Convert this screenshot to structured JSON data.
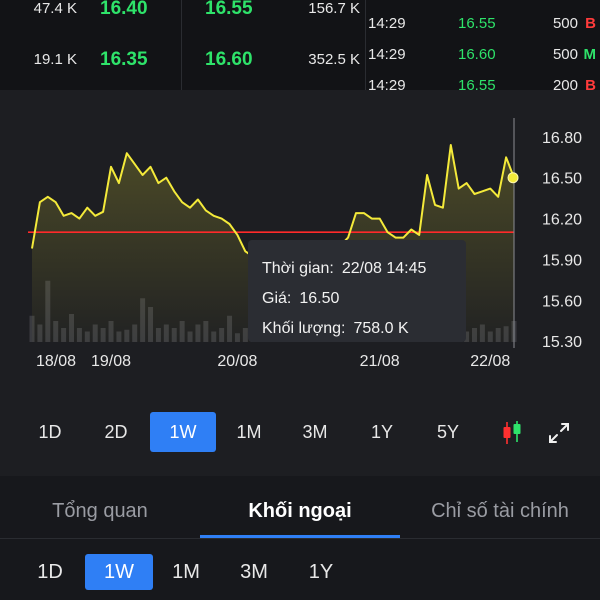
{
  "orderbook": {
    "rows": [
      {
        "bid_volume": "47.4 K",
        "bid_price": "16.40",
        "ask_price": "16.55",
        "ask_volume": "156.7 K"
      },
      {
        "bid_volume": "19.1 K",
        "bid_price": "16.35",
        "ask_price": "16.60",
        "ask_volume": "352.5 K"
      }
    ]
  },
  "trades": {
    "rows": [
      {
        "time": "14:29",
        "price": "16.55",
        "volume": "500",
        "side": "B",
        "side_color": "#ff3b3b"
      },
      {
        "time": "14:29",
        "price": "16.60",
        "volume": "500",
        "side": "M",
        "side_color": "#2ee36a"
      },
      {
        "time": "14:29",
        "price": "16.55",
        "volume": "200",
        "side": "B",
        "side_color": "#ff3b3b"
      }
    ]
  },
  "chart_data": {
    "type": "line",
    "x_ticks": [
      "18/08",
      "19/08",
      "20/08",
      "21/08",
      "22/08"
    ],
    "y_ticks": [
      "16.80",
      "16.50",
      "16.20",
      "15.90",
      "15.60",
      "15.30"
    ],
    "ylim": [
      15.25,
      16.85
    ],
    "reference_price": 16.1,
    "colors": {
      "line": "#f4ea3a",
      "reference": "#ff2a2a",
      "volume": "#3a3b40",
      "grid": "#2e3036"
    },
    "series": [
      {
        "values": [
          15.98,
          16.32,
          16.36,
          16.32,
          16.22,
          16.24,
          16.2,
          16.28,
          16.22,
          16.25,
          16.58,
          16.46,
          16.68,
          16.6,
          16.52,
          16.58,
          16.46,
          16.5,
          16.4,
          16.32,
          16.28,
          16.34,
          16.26,
          16.22,
          16.2,
          16.16,
          16.08,
          15.96,
          15.92,
          15.9,
          15.85,
          15.9,
          15.88,
          15.92,
          15.95,
          15.9,
          15.88,
          15.92,
          15.98,
          16.0,
          16.06,
          16.24,
          16.24,
          16.2,
          16.2,
          16.1,
          16.06,
          16.06,
          16.12,
          16.08,
          16.52,
          16.3,
          16.28,
          16.74,
          16.42,
          16.46,
          16.38,
          16.4,
          16.42,
          16.36,
          16.65,
          16.5
        ]
      }
    ],
    "volume": [
      0.15,
      0.1,
      0.35,
      0.12,
      0.08,
      0.16,
      0.08,
      0.06,
      0.1,
      0.08,
      0.12,
      0.06,
      0.07,
      0.1,
      0.25,
      0.2,
      0.08,
      0.1,
      0.08,
      0.12,
      0.06,
      0.1,
      0.12,
      0.06,
      0.08,
      0.15,
      0.05,
      0.08,
      0.06,
      0.1,
      0.05,
      0.06,
      0.05,
      0.08,
      0.05,
      0.06,
      0.05,
      0.06,
      0.08,
      0.05,
      0.06,
      0.05,
      0.06,
      0.05,
      0.06,
      0.05,
      0.08,
      0.1,
      0.06,
      0.06,
      0.08,
      0.05,
      0.06,
      0.1,
      0.08,
      0.06,
      0.08,
      0.1,
      0.06,
      0.08,
      0.09,
      0.12
    ]
  },
  "tooltip": {
    "time_label": "Thời gian:",
    "time_value": "22/08 14:45",
    "price_label": "Giá:",
    "price_value": "16.50",
    "volume_label": "Khối lượng:",
    "volume_value": "758.0 K"
  },
  "period_tabs": [
    "1D",
    "2D",
    "1W",
    "1M",
    "3M",
    "1Y",
    "5Y"
  ],
  "period_active": "1W",
  "icons": {
    "chart_type": "candlestick-icon",
    "expand": "expand-icon"
  },
  "info_tabs": [
    "Tổng quan",
    "Khối ngoại",
    "Chỉ số tài chính"
  ],
  "info_active": "Khối ngoại",
  "sub_period_tabs": [
    "1D",
    "1W",
    "1M",
    "3M",
    "1Y"
  ],
  "sub_period_active": "1W"
}
